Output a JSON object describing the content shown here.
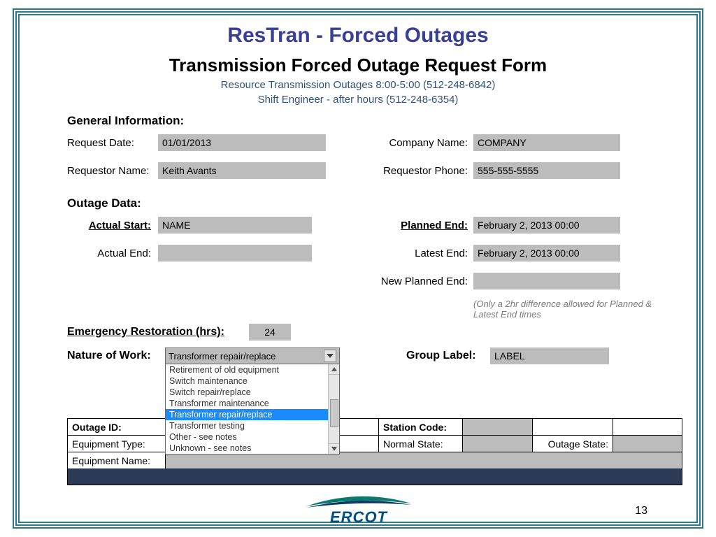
{
  "slide_title": "ResTran - Forced Outages",
  "form_title": "Transmission Forced Outage Request Form",
  "contact_line1": "Resource Transmission Outages 8:00-5:00 (512-248-6842)",
  "contact_line2": "Shift Engineer - after hours (512-248-6354)",
  "section_general": "General Information:",
  "labels": {
    "request_date": "Request Date:",
    "requestor_name": "Requestor Name:",
    "company_name": "Company Name:",
    "requestor_phone": "Requestor Phone:"
  },
  "values": {
    "request_date": "01/01/2013",
    "requestor_name": "Keith Avants",
    "company_name": "COMPANY",
    "requestor_phone": "555-555-5555"
  },
  "section_outage": "Outage Data:",
  "outage_labels": {
    "actual_start": "Actual Start:",
    "actual_end": "Actual End:",
    "planned_end": "Planned End:",
    "latest_end": "Latest End:",
    "new_planned_end": "New Planned End:"
  },
  "outage_values": {
    "actual_start": "NAME",
    "actual_end": "",
    "planned_end": "February 2, 2013 00:00",
    "latest_end": "February 2, 2013 00:00",
    "new_planned_end": ""
  },
  "end_note": "(Only a 2hr difference allowed for Planned & Latest End times",
  "emerg_label": "Emergency Restoration (hrs):",
  "emerg_value": "24",
  "nature_label": "Nature of Work:",
  "nature_selected": "Transformer repair/replace",
  "nature_options": [
    {
      "text": "Retirement of old equipment",
      "sel": false
    },
    {
      "text": "Switch maintenance",
      "sel": false
    },
    {
      "text": "Switch repair/replace",
      "sel": false
    },
    {
      "text": "Transformer maintenance",
      "sel": false
    },
    {
      "text": "Transformer repair/replace",
      "sel": true
    },
    {
      "text": "Transformer testing",
      "sel": false
    },
    {
      "text": "Other - see notes",
      "sel": false
    },
    {
      "text": "Unknown - see notes",
      "sel": false
    }
  ],
  "group_label": "Group Label:",
  "group_value": "LABEL",
  "eq": {
    "outage_id": "Outage ID:",
    "station_code": "Station Code:",
    "equipment_type": "Equipment Type:",
    "normal_state": "Normal State:",
    "outage_state": "Outage State:",
    "equipment_name": "Equipment Name:"
  },
  "logo_text": "ERCOT",
  "page_number": "13"
}
